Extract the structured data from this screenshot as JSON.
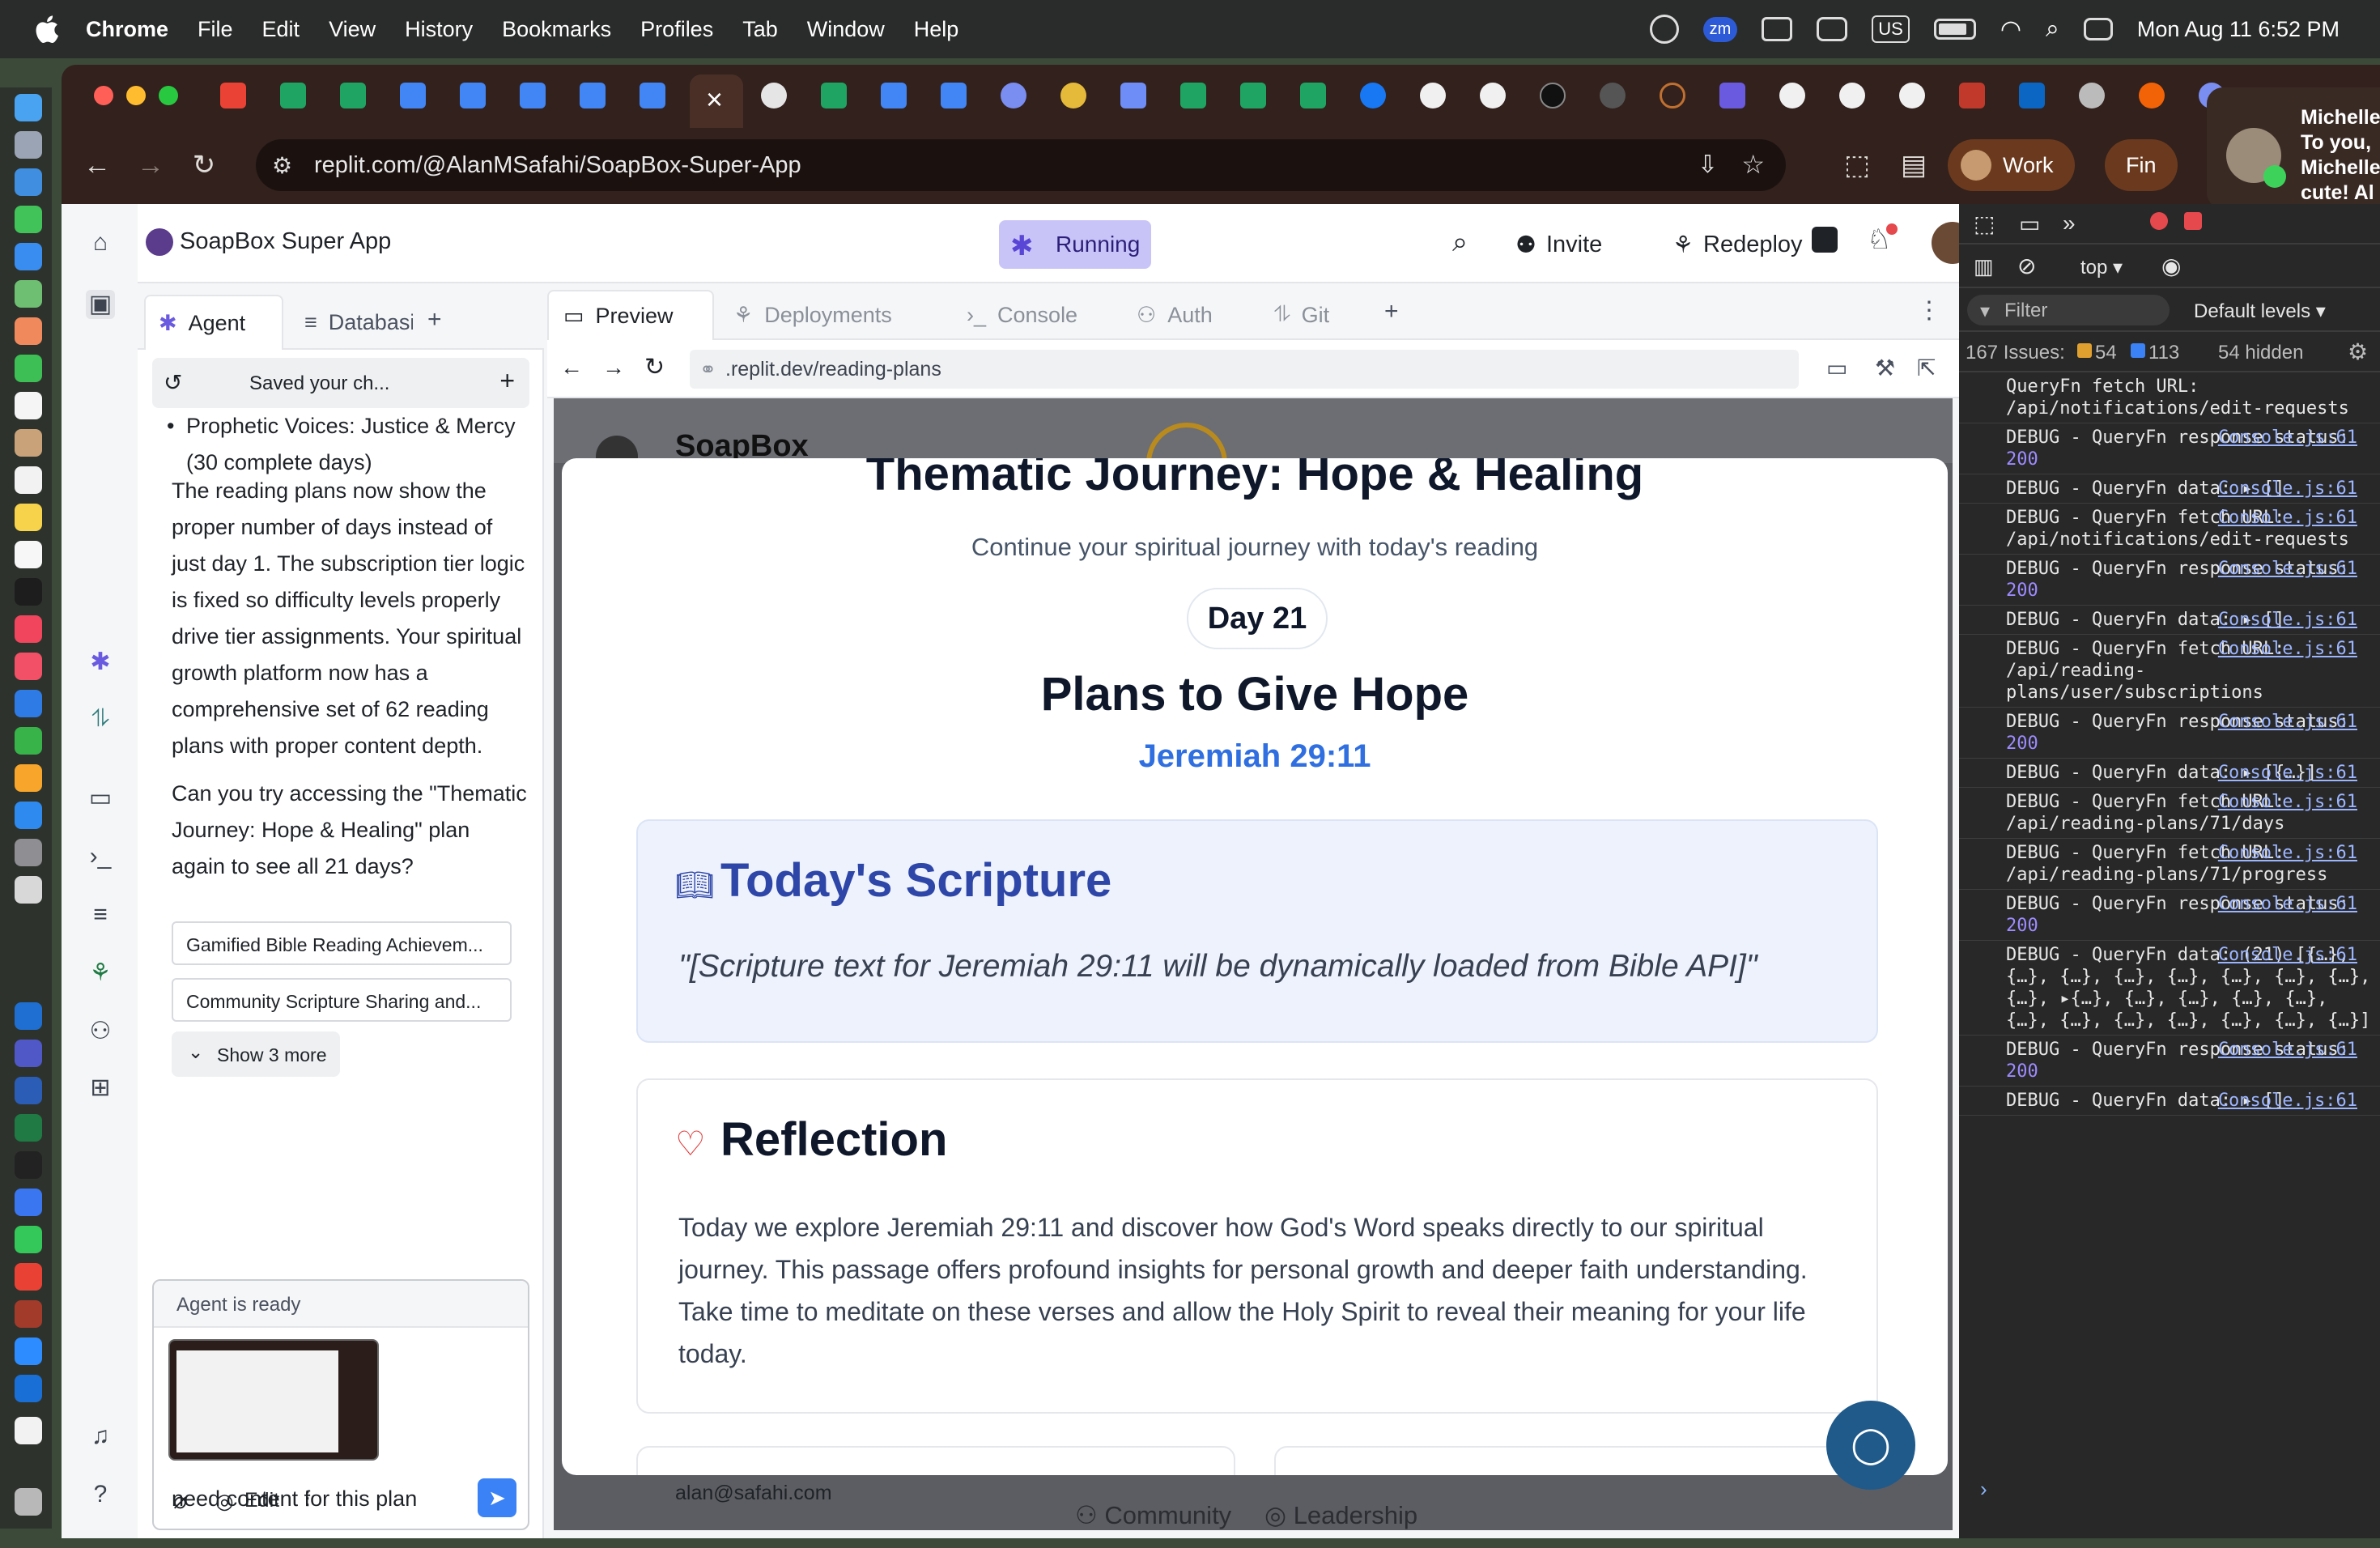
{
  "menubar": {
    "app_name": "Chrome",
    "items": [
      "File",
      "Edit",
      "View",
      "History",
      "Bookmarks",
      "Profiles",
      "Tab",
      "Window",
      "Help"
    ],
    "input_source": "US",
    "zoom_badge": "zm",
    "datetime": "Mon Aug 11  6:52 PM"
  },
  "browser": {
    "url": "replit.com/@AlanMSafahi/SoapBox-Super-App",
    "profile_label": "Work",
    "profile_label_2": "Fin",
    "close_tab_glyph": "×"
  },
  "notification": {
    "lines": [
      "Michelle",
      "To you,",
      "Michelle",
      "cute! Al"
    ]
  },
  "replit": {
    "app_name": "SoapBox Super App",
    "run_status": "Running",
    "invite_label": "Invite",
    "redeploy_label": "Redeploy",
    "agent_tabs": [
      "Agent",
      "Databasi"
    ],
    "history_label": "Saved your ch...",
    "agent_messages": {
      "bullet": "Prophetic Voices: Justice & Mercy (30 complete days)",
      "paragraph1": "The reading plans now show the proper number of days instead of just day 1. The subscription tier logic is fixed so difficulty levels properly drive tier assignments. Your spiritual growth platform now has a comprehensive set of 62 reading plans with proper content depth.",
      "paragraph2": "Can you try accessing the \"Thematic Journey: Hope & Healing\" plan again to see all 21 days?"
    },
    "suggestions": [
      "Gamified Bible Reading Achievem...",
      "Community Scripture Sharing and..."
    ],
    "show_more": "Show 3 more",
    "chat": {
      "status": "Agent is ready",
      "input_text": "need content for this plan",
      "edit_label": "Edit"
    },
    "panel_tabs": [
      "Preview",
      "Deployments",
      "Console",
      "Auth",
      "Git"
    ],
    "preview_url": ".replit.dev/reading-plans"
  },
  "webpage": {
    "brand": "SoapBox",
    "modal_title": "Thematic Journey: Hope & Healing",
    "subtitle": "Continue your spiritual journey with today's reading",
    "day_label": "Day 21",
    "reading_title": "Plans to Give Hope",
    "reference": "Jeremiah 29:11",
    "scripture_heading": "Today's Scripture",
    "scripture_text": "\"[Scripture text for Jeremiah 29:11 will be dynamically loaded from Bible API]\"",
    "reflection_heading": "Reflection",
    "reflection_text": "Today we explore Jeremiah 29:11 and discover how God's Word speaks directly to our spiritual journey. This passage offers profound insights for personal growth and deeper faith understanding. Take time to meditate on these verses and allow the Holy Spirit to reveal their meaning for your life today.",
    "bg_email": "alan@safahi.com",
    "bg_nav": [
      "Community",
      "Leadership"
    ]
  },
  "devtools": {
    "context": "top",
    "filter_placeholder": "Filter",
    "levels": "Default levels",
    "issues_label": "167 Issues:",
    "issues_warn": "54",
    "issues_info": "113",
    "hidden": "54 hidden",
    "logs": [
      {
        "text": "QueryFn fetch URL: /api/notifications/edit-requests",
        "source": ""
      },
      {
        "text": "DEBUG - QueryFn response status: ",
        "num": "200",
        "source": "Console.js:61"
      },
      {
        "text": "DEBUG - QueryFn data: ▸ []",
        "source": "Console.js:61"
      },
      {
        "text": "DEBUG - QueryFn fetch URL: /api/notifications/edit-requests",
        "source": "Console.js:61"
      },
      {
        "text": "DEBUG - QueryFn response status: ",
        "num": "200",
        "source": "Console.js:61"
      },
      {
        "text": "DEBUG - QueryFn data: ▸ []",
        "source": "Console.js:61"
      },
      {
        "text": "DEBUG - QueryFn fetch URL: /api/reading-plans/user/subscriptions",
        "source": "Console.js:61"
      },
      {
        "text": "DEBUG - QueryFn response status: ",
        "num": "200",
        "source": "Console.js:61"
      },
      {
        "text": "DEBUG - QueryFn data: ▸ [{…}]",
        "source": "Console.js:61"
      },
      {
        "text": "DEBUG - QueryFn fetch URL: /api/reading-plans/71/days",
        "source": "Console.js:61"
      },
      {
        "text": "DEBUG - QueryFn fetch URL: /api/reading-plans/71/progress",
        "source": "Console.js:61"
      },
      {
        "text": "DEBUG - QueryFn response status: ",
        "num": "200",
        "source": "Console.js:61"
      },
      {
        "text": "DEBUG - QueryFn data: (21) [{…}, {…}, {…}, {…}, {…}, {…}, {…}, {…}, {…}, ▸{…}, {…}, {…}, {…}, {…}, {…}, {…}, {…}, {…}, {…}, {…}, {…}]",
        "source": "Console.js:61"
      },
      {
        "text": "DEBUG - QueryFn response status: ",
        "num": "200",
        "source": "Console.js:61"
      },
      {
        "text": "DEBUG - QueryFn data: ▸ []",
        "source": "Console.js:61"
      }
    ]
  },
  "colors": {
    "accent_blue": "#2f6fe0",
    "running_purple": "#c9c4f7",
    "browser_frame": "#32211c",
    "devtools_bg": "#282828"
  }
}
